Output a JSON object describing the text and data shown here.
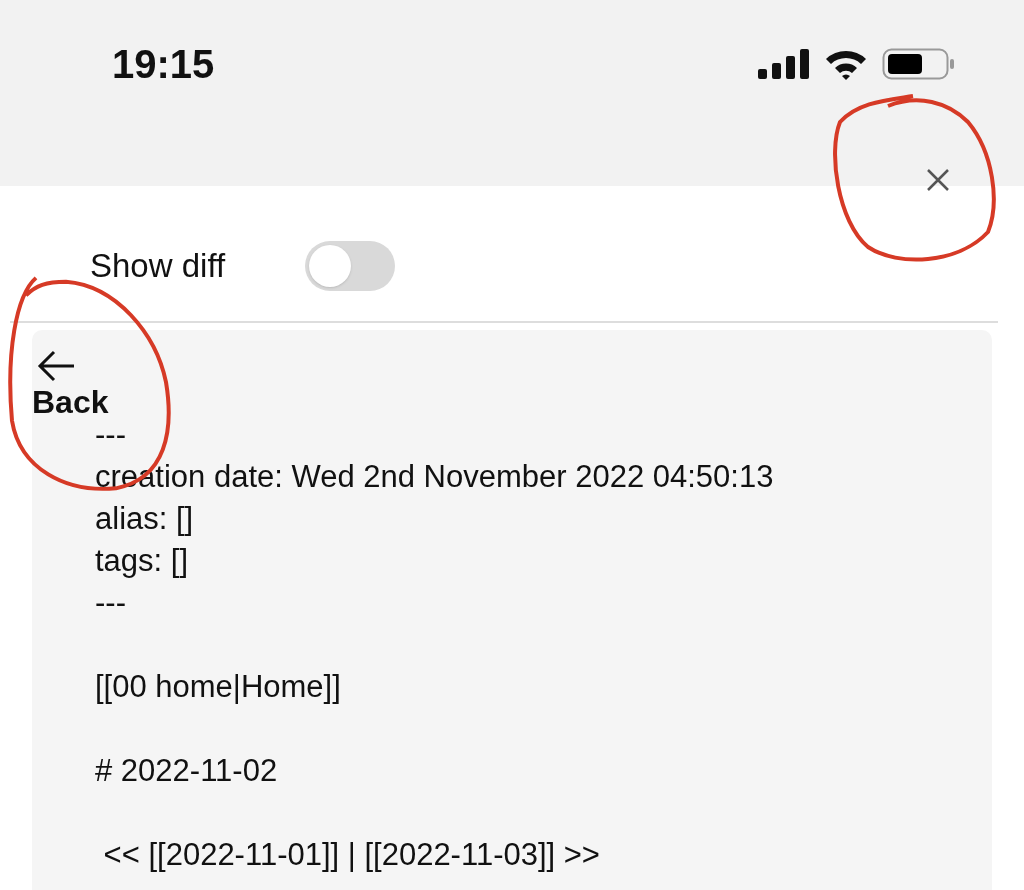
{
  "status_bar": {
    "time": "19:15"
  },
  "show_diff": {
    "label": "Show diff",
    "on": false
  },
  "back_button": {
    "label": "Back"
  },
  "content": {
    "blocks": [
      [
        "---",
        "creation date: Wed 2nd November 2022 04:50:13",
        "alias: []",
        "tags: []",
        "---"
      ],
      [
        "[[00 home|Home]]"
      ],
      [
        "# 2022-11-02"
      ],
      [
        " << [[2022-11-01]] | [[2022-11-03]] >>"
      ]
    ]
  }
}
